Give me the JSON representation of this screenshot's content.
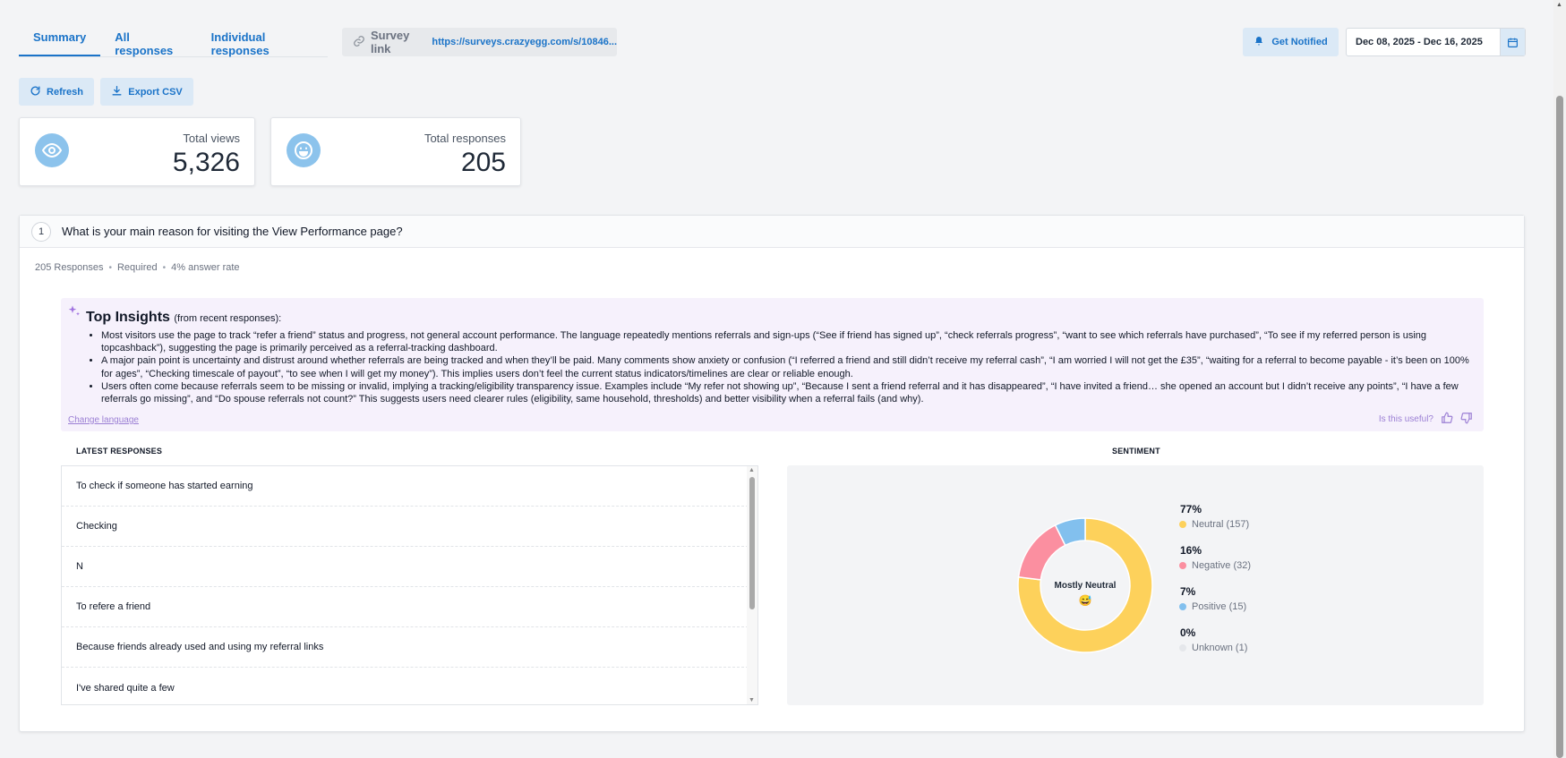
{
  "tabs": [
    {
      "label": "Summary",
      "active": true
    },
    {
      "label": "All responses",
      "active": false
    },
    {
      "label": "Individual responses",
      "active": false
    }
  ],
  "survey_link": {
    "label": "Survey link",
    "url": "https://surveys.crazyegg.com/s/10846..."
  },
  "notify_label": "Get Notified",
  "date_range": "Dec 08, 2025 - Dec 16, 2025",
  "toolbar": {
    "refresh_label": "Refresh",
    "export_label": "Export CSV"
  },
  "stats": {
    "views": {
      "label": "Total views",
      "value": "5,326"
    },
    "responses": {
      "label": "Total responses",
      "value": "205"
    }
  },
  "question": {
    "number": "1",
    "text": "What is your main reason for visiting the View Performance page?",
    "responses": "205 Responses",
    "required": "Required",
    "answer_rate": "4% answer rate"
  },
  "insights": {
    "title": "Top Insights",
    "subtitle": "(from recent responses):",
    "items": [
      "Most visitors use the page to track “refer a friend” status and progress, not general account performance. The language repeatedly mentions referrals and sign-ups (“See if friend has signed up”, “check referrals progress”, “want to see which referrals have purchased”, “To see if my referred person is using topcashback”), suggesting the page is primarily perceived as a referral-tracking dashboard.",
      "A major pain point is uncertainty and distrust around whether referrals are being tracked and when they’ll be paid. Many comments show anxiety or confusion (“I referred a friend and still didn’t receive my referral cash”, “I am worried I will not get the £35”, “waiting for a referral to become payable - it’s been on 100% for ages”, “Checking timescale of payout”, “to see when I will get my money”). This implies users don’t feel the current status indicators/timelines are clear or reliable enough.",
      "Users often come because referrals seem to be missing or invalid, implying a tracking/eligibility transparency issue. Examples include “My refer not showing up”, “Because I sent a friend referral and it has disappeared”, “I have invited a friend… she opened an account but I didn’t receive any points”, “I have a few referrals go missing”, and “Do spouse referrals not count?” This suggests users need clearer rules (eligibility, same household, thresholds) and better visibility when a referral fails (and why)."
    ],
    "change_language": "Change language",
    "useful_prompt": "Is this useful?"
  },
  "latest": {
    "title": "LATEST RESPONSES",
    "items": [
      "To check if someone has started earning",
      "Checking",
      "N",
      "To refere a friend",
      "Because friends already used and using my referral links",
      "I've shared quite a few"
    ]
  },
  "sentiment": {
    "title": "SENTIMENT",
    "center_label": "Mostly Neutral",
    "center_emoji": "😅",
    "legend": [
      {
        "pct": "77%",
        "label": "Neutral (157)",
        "color": "#fdd15b",
        "value": 157
      },
      {
        "pct": "16%",
        "label": "Negative (32)",
        "color": "#fb8fa0",
        "value": 32
      },
      {
        "pct": "7%",
        "label": "Positive (15)",
        "color": "#82c0ee",
        "value": 15
      },
      {
        "pct": "0%",
        "label": "Unknown (1)",
        "color": "#e5e7eb",
        "value": 1
      }
    ]
  }
}
